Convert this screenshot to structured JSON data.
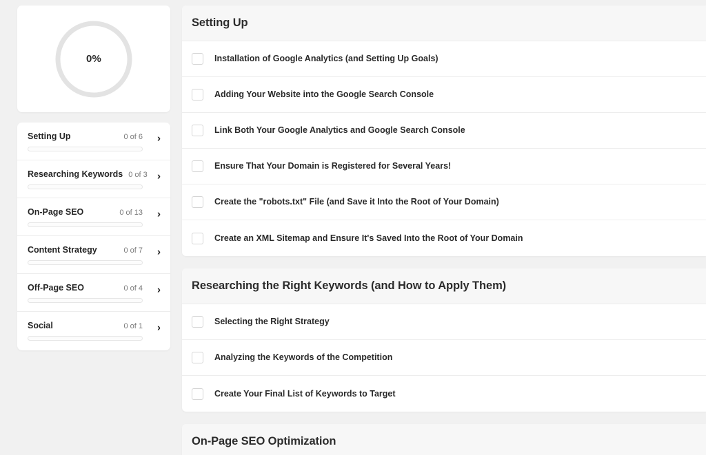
{
  "progress": {
    "percent_label": "0%",
    "percent_value": 0,
    "ring_track_color": "#e3e3e3",
    "ring_fill_color": "#4a4a4a"
  },
  "sidebar": {
    "items": [
      {
        "label": "Setting Up",
        "count": "0 of 6",
        "progress_percent": 0
      },
      {
        "label": "Researching Keywords",
        "count": "0 of 3",
        "progress_percent": 0
      },
      {
        "label": "On-Page SEO",
        "count": "0 of 13",
        "progress_percent": 0
      },
      {
        "label": "Content Strategy",
        "count": "0 of 7",
        "progress_percent": 0
      },
      {
        "label": "Off-Page SEO",
        "count": "0 of 4",
        "progress_percent": 0
      },
      {
        "label": "Social",
        "count": "0 of 1",
        "progress_percent": 0
      }
    ],
    "chevron_icon": "›"
  },
  "main": {
    "sections": [
      {
        "title": "Setting Up",
        "tasks": [
          {
            "label": "Installation of Google Analytics (and Setting Up Goals)",
            "checked": false
          },
          {
            "label": "Adding Your Website into the Google Search Console",
            "checked": false
          },
          {
            "label": "Link Both Your Google Analytics and Google Search Console",
            "checked": false
          },
          {
            "label": "Ensure That Your Domain is Registered for Several Years!",
            "checked": false
          },
          {
            "label": "Create the \"robots.txt\" File (and Save it Into the Root of Your Domain)",
            "checked": false
          },
          {
            "label": "Create an XML Sitemap and Ensure It's Saved Into the Root of Your Domain",
            "checked": false
          }
        ]
      },
      {
        "title": "Researching the Right Keywords (and How to Apply Them)",
        "tasks": [
          {
            "label": "Selecting the Right Strategy",
            "checked": false
          },
          {
            "label": "Analyzing the Keywords of the Competition",
            "checked": false
          },
          {
            "label": "Create Your Final List of Keywords to Target",
            "checked": false
          }
        ]
      },
      {
        "title": "On-Page SEO Optimization",
        "tasks": []
      }
    ]
  },
  "colors": {
    "page_background": "#f1f1f1",
    "card_background": "#ffffff",
    "header_background": "#f7f7f7",
    "divider": "#ededed",
    "text_primary": "#2a2a2a",
    "text_muted": "#7a7a7a"
  }
}
